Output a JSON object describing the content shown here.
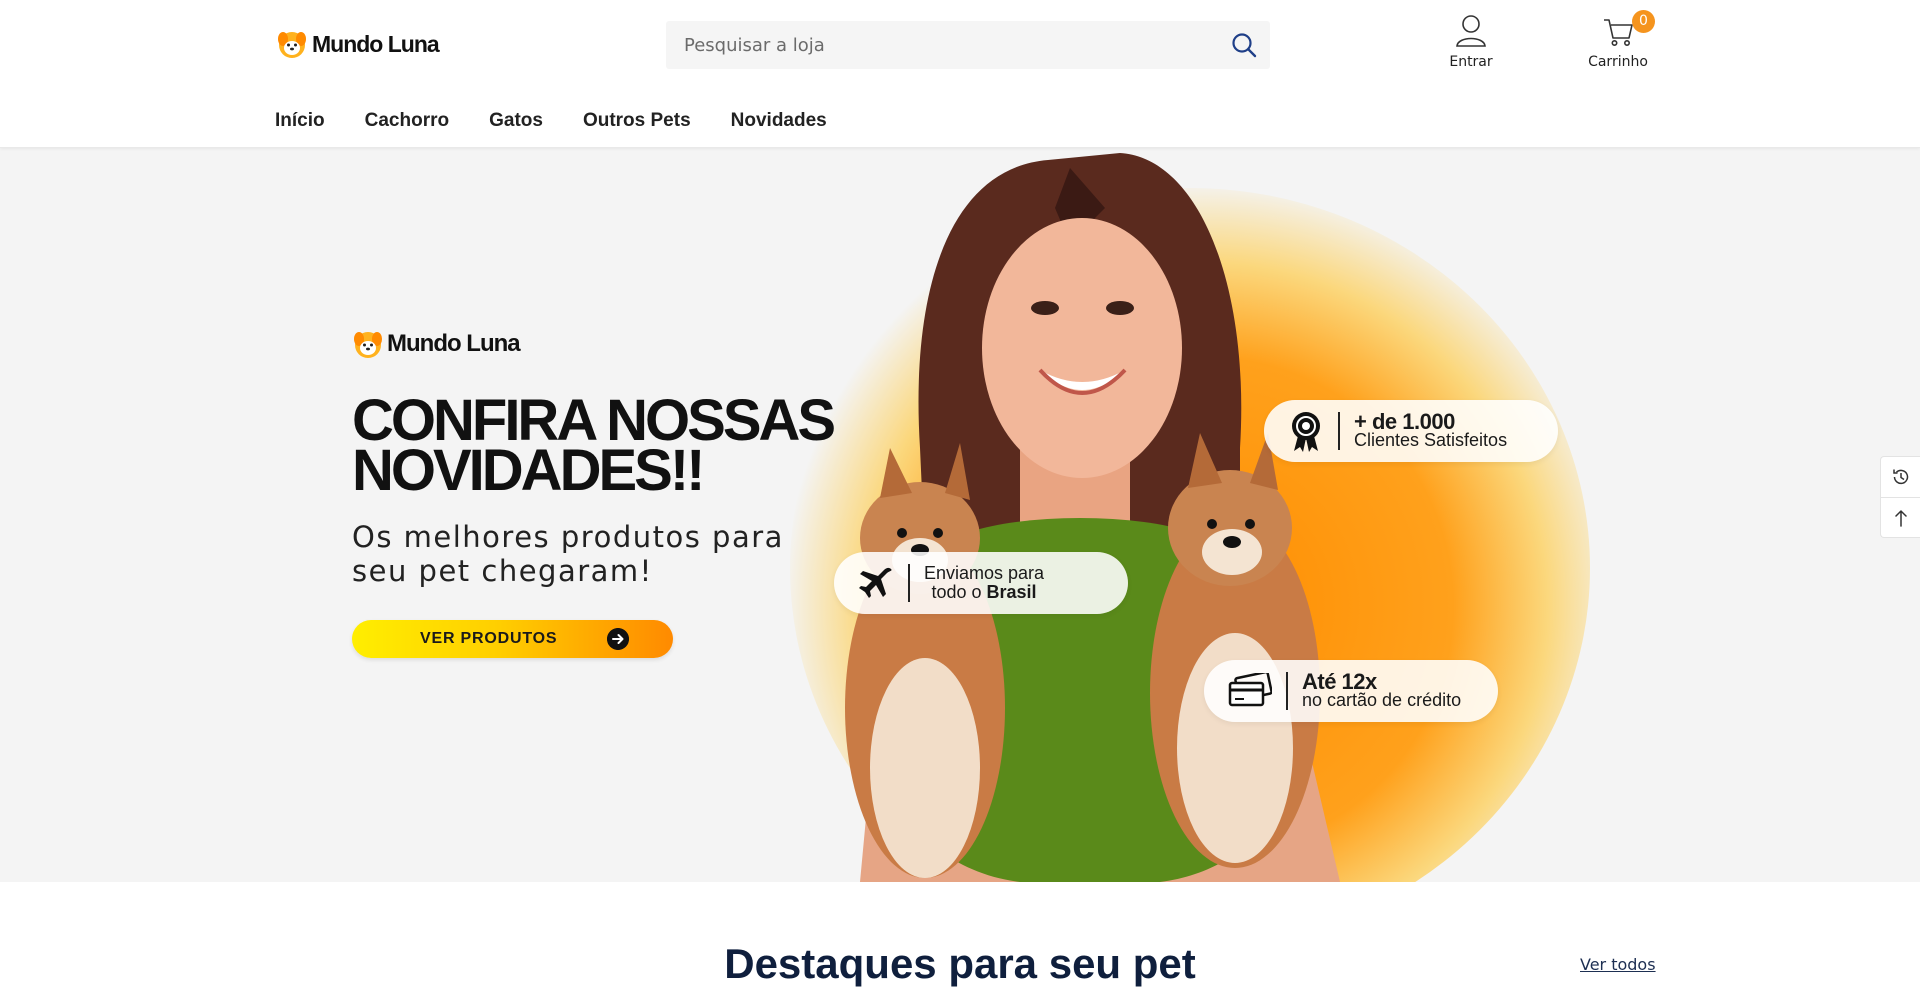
{
  "header": {
    "logo_text": "Mundo Luna",
    "search_placeholder": "Pesquisar a loja",
    "account_label": "Entrar",
    "cart_label": "Carrinho",
    "cart_count": "0"
  },
  "nav": {
    "items": [
      "Início",
      "Cachorro",
      "Gatos",
      "Outros Pets",
      "Novidades"
    ]
  },
  "hero": {
    "logo_text": "Mundo Luna",
    "title_line1": "CONFIRA NOSSAS",
    "title_line2": "NOVIDADES!!",
    "subtitle_line1": "Os melhores produtos para",
    "subtitle_line2": "seu pet chegaram!",
    "cta_label": "VER PRODUTOS",
    "badge_clients_big": "+ de 1.000",
    "badge_clients_small": "Clientes Satisfeitos",
    "badge_shipping_line1": "Enviamos para",
    "badge_shipping_line2_a": "todo o ",
    "badge_shipping_line2_b": "Brasil",
    "badge_installments_big": "Até 12x",
    "badge_installments_small": "no cartão de crédito"
  },
  "section": {
    "title": "Destaques para seu pet",
    "view_all": "Ver todos"
  },
  "icons": {
    "search": "search-icon",
    "account": "user-icon",
    "cart": "cart-icon",
    "history": "history-icon",
    "back_to_top": "arrow-up-icon"
  },
  "colors": {
    "accent_orange": "#f5941e",
    "heading_navy": "#0f1f3d",
    "search_icon_blue": "#1f3f88"
  }
}
